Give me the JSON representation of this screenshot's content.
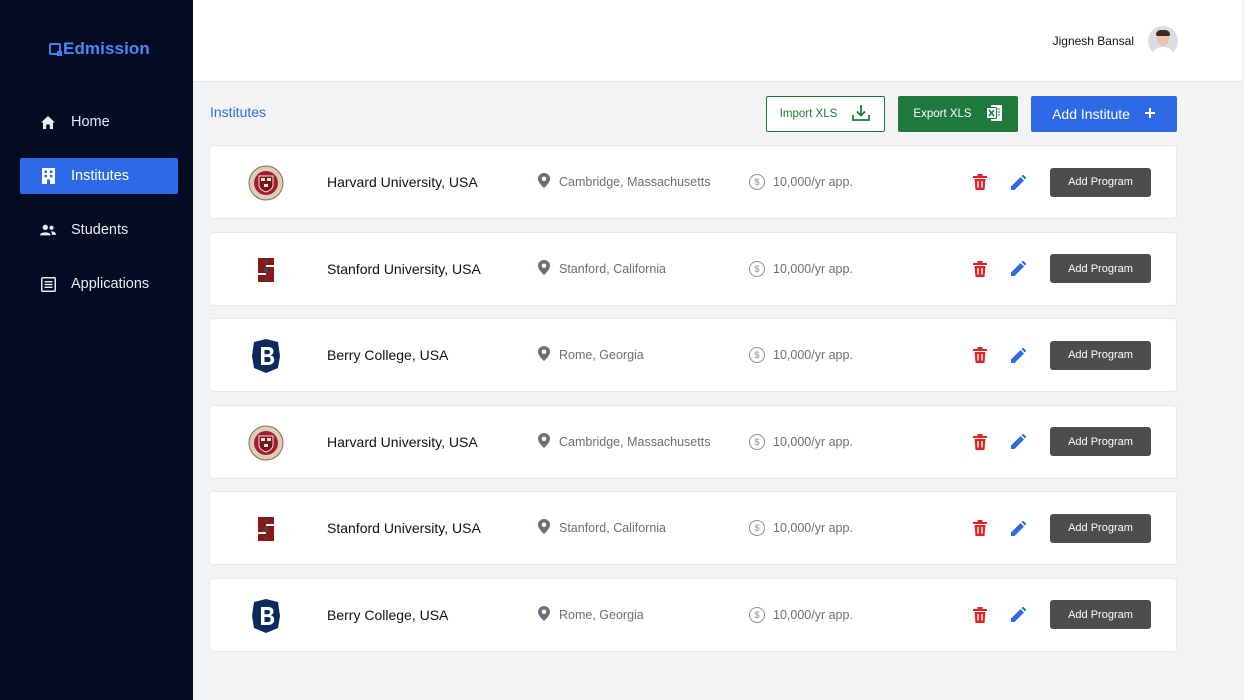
{
  "brand": {
    "name": "Edmission"
  },
  "colors": {
    "sidebar_bg": "#040c24",
    "accent": "#2f6ae6",
    "excel_green": "#1e7a3c",
    "delete_red": "#e02424",
    "dark_button": "#4d4d4d"
  },
  "nav": [
    {
      "label": "Home",
      "icon": "home-icon",
      "active": false
    },
    {
      "label": "Institutes",
      "icon": "building-icon",
      "active": true
    },
    {
      "label": "Students",
      "icon": "users-icon",
      "active": false
    },
    {
      "label": "Applications",
      "icon": "list-icon",
      "active": false
    }
  ],
  "header": {
    "user_name": "Jignesh Bansal"
  },
  "page": {
    "title": "Institutes"
  },
  "toolbar": {
    "import_label": "Import  XLS",
    "export_label": "Export XLS",
    "add_label": "Add Institute"
  },
  "institutes": [
    {
      "name": "Harvard University, USA",
      "location": "Cambridge, Massachusetts",
      "fee": "10,000/yr app.",
      "logo": "harvard-logo",
      "action_label": "Add Program"
    },
    {
      "name": "Stanford University, USA",
      "location": "Stanford, California",
      "fee": "10,000/yr app.",
      "logo": "stanford-logo",
      "action_label": "Add Program"
    },
    {
      "name": "Berry College, USA",
      "location": "Rome, Georgia",
      "fee": "10,000/yr app.",
      "logo": "berry-logo",
      "action_label": "Add Program"
    },
    {
      "name": "Harvard University, USA",
      "location": "Cambridge, Massachusetts",
      "fee": "10,000/yr app.",
      "logo": "harvard-logo",
      "action_label": "Add Program"
    },
    {
      "name": "Stanford University, USA",
      "location": "Stanford, California",
      "fee": "10,000/yr app.",
      "logo": "stanford-logo",
      "action_label": "Add Program"
    },
    {
      "name": "Berry College, USA",
      "location": "Rome, Georgia",
      "fee": "10,000/yr app.",
      "logo": "berry-logo",
      "action_label": "Add Program"
    }
  ]
}
